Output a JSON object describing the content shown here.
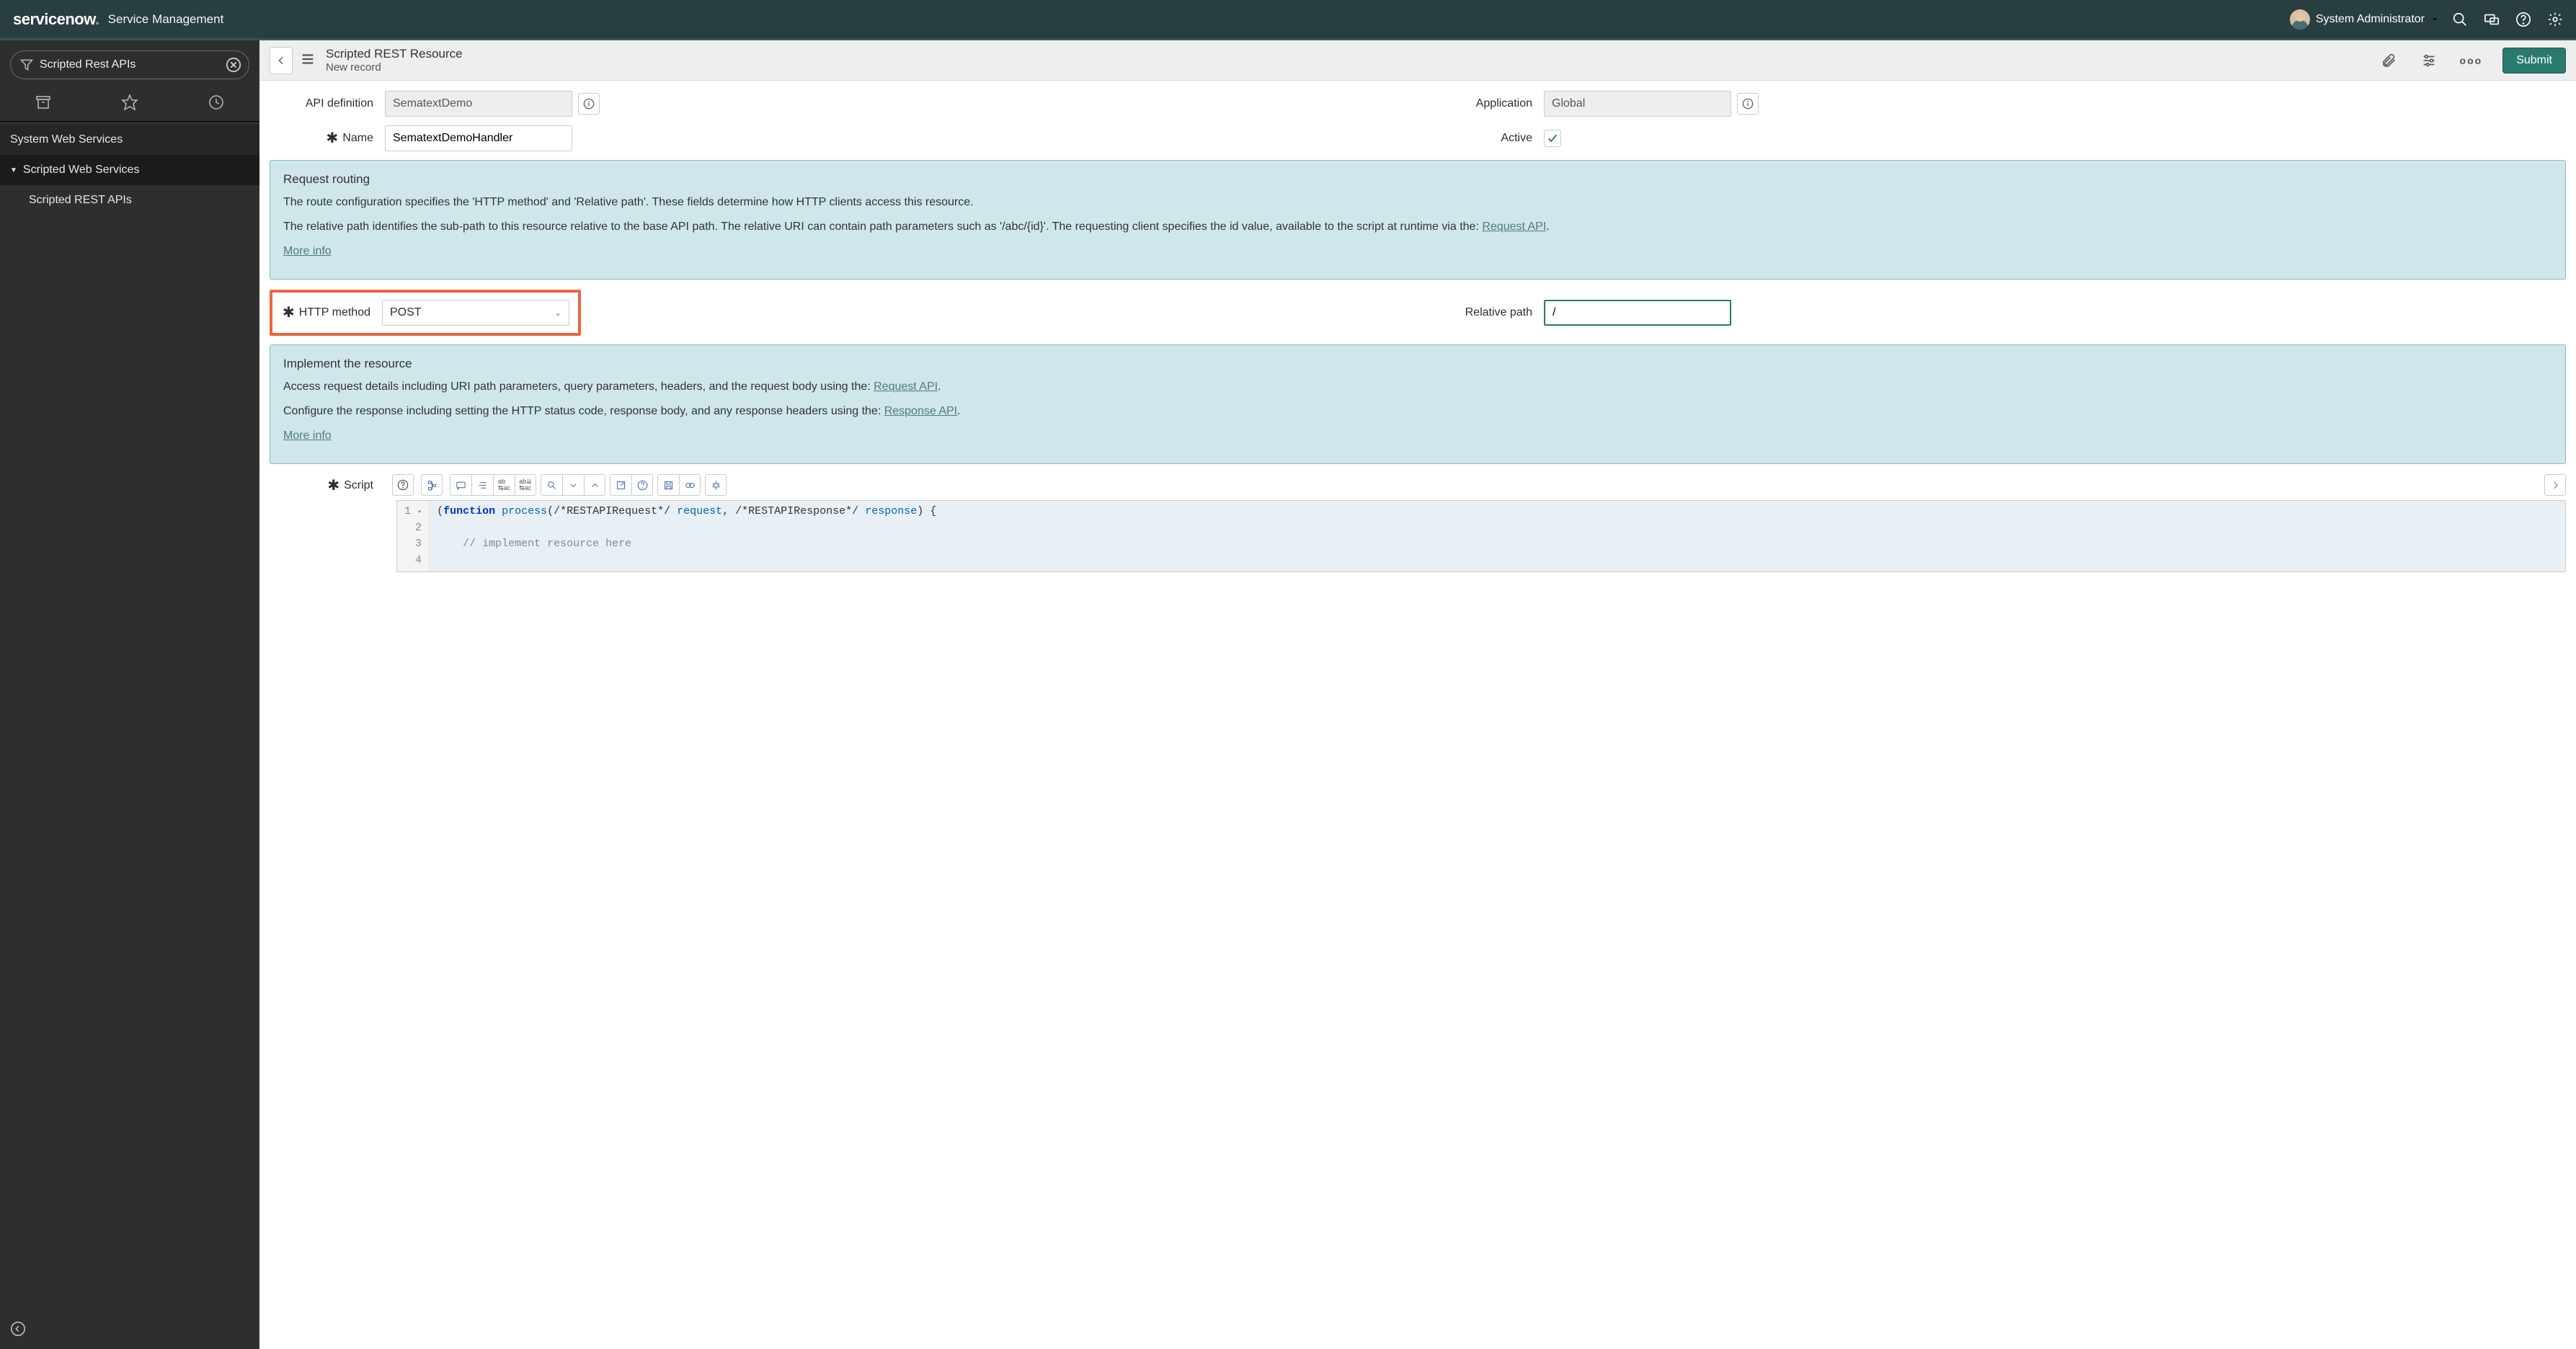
{
  "header": {
    "logo_text": "servicenow",
    "product": "Service Management",
    "user": "System Administrator"
  },
  "sidebar": {
    "search_value": "Scripted Rest APIs",
    "section": "System Web Services",
    "group": "Scripted Web Services",
    "item": "Scripted REST APIs"
  },
  "form_header": {
    "title": "Scripted REST Resource",
    "subtitle": "New record",
    "submit": "Submit"
  },
  "fields": {
    "api_definition_label": "API definition",
    "api_definition_value": "SematextDemo",
    "application_label": "Application",
    "application_value": "Global",
    "name_label": "Name",
    "name_value": "SematextDemoHandler",
    "active_label": "Active",
    "http_method_label": "HTTP method",
    "http_method_value": "POST",
    "relative_path_label": "Relative path",
    "relative_path_value": "/",
    "script_label": "Script"
  },
  "callout1": {
    "heading": "Request routing",
    "p1": "The route configuration specifies the 'HTTP method' and 'Relative path'. These fields determine how HTTP clients access this resource.",
    "p2a": "The relative path identifies the sub-path to this resource relative to the base API path. The relative URI can contain path parameters such as '/abc/{id}'. The requesting client specifies the id value, available to the script at runtime via the: ",
    "p2link": "Request API",
    "more": "More info"
  },
  "callout2": {
    "heading": "Implement the resource",
    "p1a": "Access request details including URI path parameters, query parameters, headers, and the request body using the: ",
    "p1link": "Request API",
    "p2a": "Configure the response including setting the HTTP status code, response body, and any response headers using the: ",
    "p2link": "Response API",
    "more": "More info"
  },
  "code": {
    "l1_a": "(",
    "l1_b": "function",
    "l1_c": " process",
    "l1_d": "(/*RESTAPIRequest*/ ",
    "l1_e": "request",
    "l1_f": ", /*RESTAPIResponse*/ ",
    "l1_g": "response",
    "l1_h": ") {",
    "l2": "",
    "l3": "    // implement resource here",
    "gutter": [
      "1",
      "2",
      "3",
      "4"
    ]
  }
}
